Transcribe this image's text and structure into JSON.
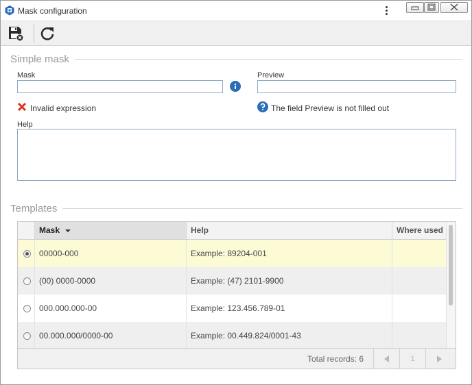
{
  "window": {
    "title": "Mask configuration"
  },
  "simple_mask": {
    "section_title": "Simple mask",
    "mask_label": "Mask",
    "mask_value": "",
    "preview_label": "Preview",
    "preview_value": "",
    "mask_error": "Invalid expression",
    "preview_message": "The field Preview is not filled out",
    "help_label": "Help",
    "help_value": ""
  },
  "templates": {
    "section_title": "Templates",
    "columns": {
      "mask": "Mask",
      "help": "Help",
      "where_used": "Where used"
    },
    "rows": [
      {
        "mask": "00000-000",
        "help": "Example: 89204-001",
        "where_used": "",
        "selected": true
      },
      {
        "mask": "(00) 0000-0000",
        "help": "Example: (47) 2101-9900",
        "where_used": "",
        "selected": false
      },
      {
        "mask": "000.000.000-00",
        "help": "Example: 123.456.789-01",
        "where_used": "",
        "selected": false
      },
      {
        "mask": "00.000.000/0000-00",
        "help": "Example: 00.449.824/0001-43",
        "where_used": "",
        "selected": false
      }
    ],
    "footer": {
      "total_records": "Total records: 6",
      "page": "1"
    }
  },
  "colors": {
    "selected_row": "#fdfbd6",
    "error": "#d9341e",
    "info": "#2a6db8"
  }
}
